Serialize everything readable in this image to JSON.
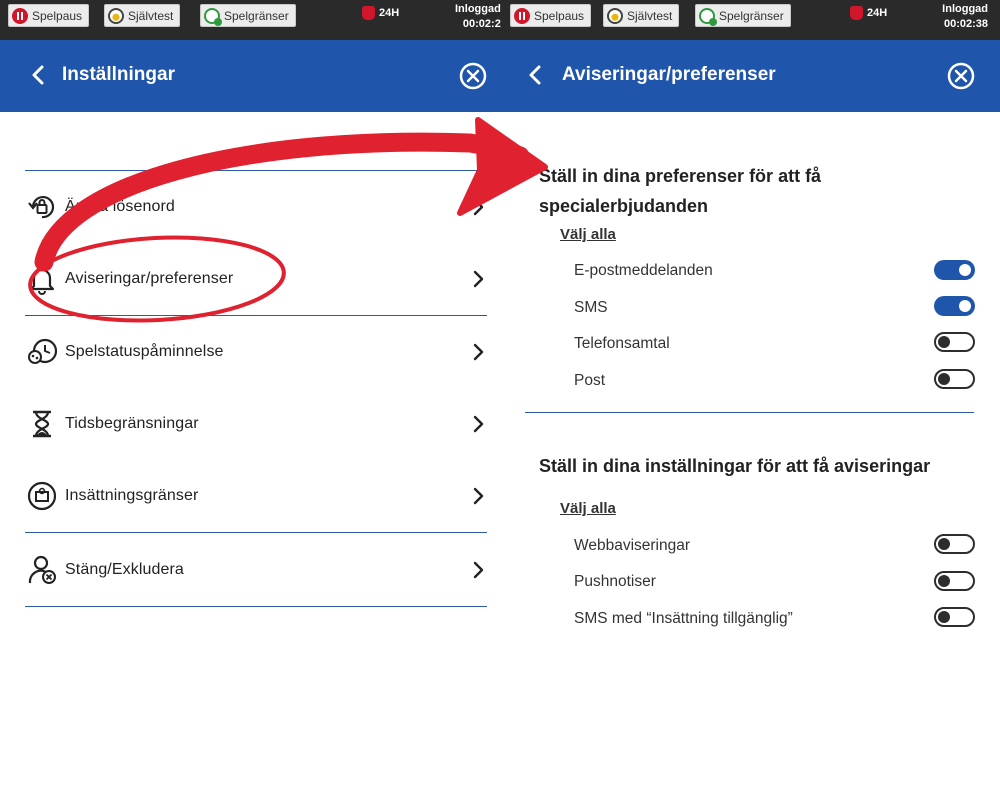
{
  "topbar": {
    "pause_label": "Spelpaus",
    "selftest_label": "Självtest",
    "limits_label": "Spelgränser",
    "badge_24h": "24H",
    "status_label": "Inloggad",
    "left_timer": "00:02:2",
    "right_timer": "00:02:38"
  },
  "settings": {
    "title": "Inställningar",
    "items": [
      {
        "label": "Ändra lösenord",
        "icon": "password-reset-icon"
      },
      {
        "label": "Aviseringar/preferenser",
        "icon": "bell-icon"
      },
      {
        "label": "Spelstatuspåminnelse",
        "icon": "game-status-reminder-icon"
      },
      {
        "label": "Tidsbegränsningar",
        "icon": "hourglass-icon"
      },
      {
        "label": "Insättningsgränser",
        "icon": "deposit-limit-icon"
      },
      {
        "label": "Stäng/Exkludera",
        "icon": "close-exclude-icon"
      }
    ]
  },
  "notifications": {
    "title": "Aviseringar/preferenser",
    "offers_title_line1": "Ställ in dina preferenser för att få",
    "offers_title_line2": "specialerbjudanden",
    "select_all": "Välj alla",
    "offers": [
      {
        "label": "E-postmeddelanden",
        "enabled": true
      },
      {
        "label": "SMS",
        "enabled": true
      },
      {
        "label": "Telefonsamtal",
        "enabled": false
      },
      {
        "label": "Post",
        "enabled": false
      }
    ],
    "alerts_title": "Ställ in dina inställningar för att få aviseringar",
    "alerts": [
      {
        "label": "Webbaviseringar",
        "enabled": false
      },
      {
        "label": "Pushnotiser",
        "enabled": false
      },
      {
        "label": "SMS med “Insättning tillgänglig”",
        "enabled": false
      }
    ]
  },
  "colors": {
    "header_blue": "#1f56ab",
    "topbar_dark": "#2a2a2a",
    "annotation_red": "#e0212f"
  }
}
